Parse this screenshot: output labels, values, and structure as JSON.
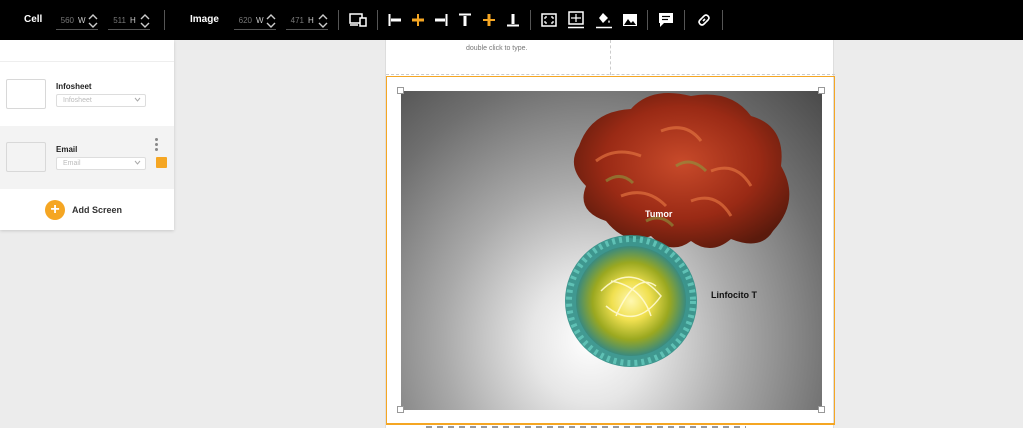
{
  "toolbar": {
    "cell_label": "Cell",
    "cell_width": "560",
    "cell_width_unit": "W",
    "cell_height": "511",
    "cell_height_unit": "H",
    "image_label": "Image",
    "image_width": "620",
    "image_width_unit": "W",
    "image_height": "471",
    "image_height_unit": "H",
    "icons": [
      "responsive-icon",
      "align-left-icon",
      "align-center-horizontal-icon",
      "align-right-icon",
      "align-top-icon",
      "align-center-vertical-icon",
      "align-bottom-icon",
      "fit-image-icon",
      "crop-image-icon",
      "fill-color-icon",
      "replace-image-icon",
      "comment-icon",
      "link-icon"
    ],
    "accent": "#f5a623"
  },
  "sidebar": {
    "screens": [
      {
        "title": "Infosheet",
        "select_value": "Infosheet"
      },
      {
        "title": "Email",
        "select_value": "Email"
      }
    ],
    "add_label": "Add Screen"
  },
  "canvas": {
    "hint_text": "double click to type.",
    "labels": {
      "tumor": "Tumor",
      "lymphocyte": "Linfocito T"
    }
  }
}
